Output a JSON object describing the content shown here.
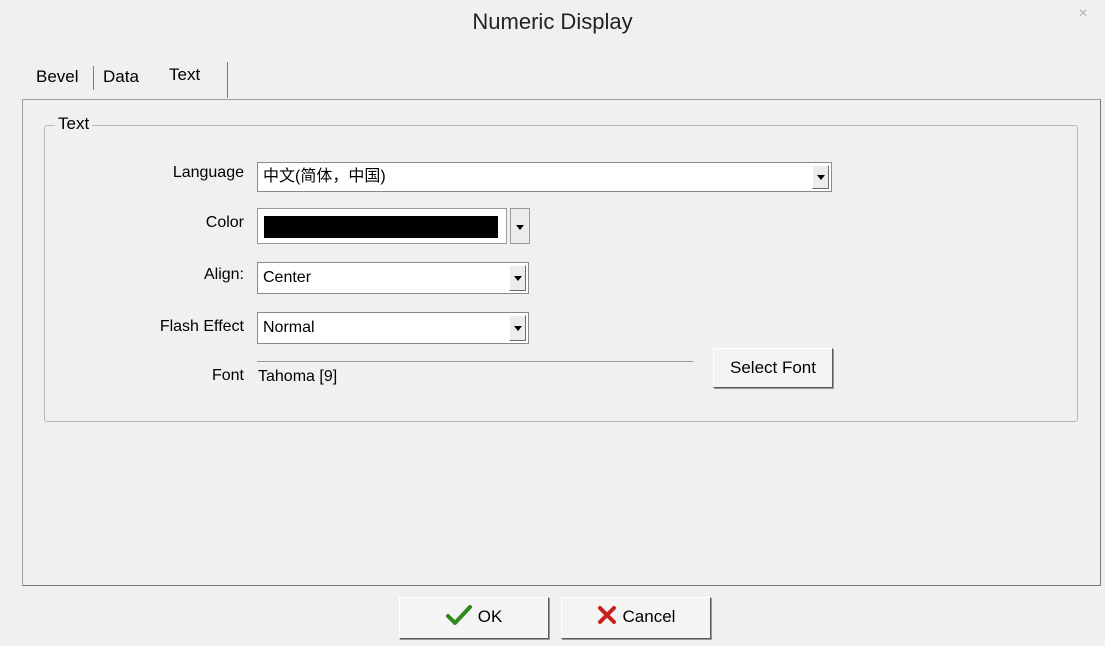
{
  "window": {
    "title": "Numeric Display",
    "close_glyph": "×"
  },
  "tabs": [
    {
      "label": "Bevel",
      "selected": false
    },
    {
      "label": "Data",
      "selected": false
    },
    {
      "label": "Text",
      "selected": true
    }
  ],
  "group": {
    "title": "Text",
    "language": {
      "label": "Language",
      "value": "中文(简体，中国)"
    },
    "color": {
      "label": "Color",
      "value": "#000000"
    },
    "align": {
      "label": "Align:",
      "value": "Center"
    },
    "flash": {
      "label": "Flash Effect",
      "value": "Normal"
    },
    "font": {
      "label": "Font",
      "value": "Tahoma [9]",
      "button": "Select Font"
    }
  },
  "buttons": {
    "ok": {
      "label": "OK",
      "icon": "checkmark-icon",
      "icon_color": "#2e8b1a"
    },
    "cancel": {
      "label": "Cancel",
      "icon": "x-icon",
      "icon_color": "#c8201a"
    }
  }
}
